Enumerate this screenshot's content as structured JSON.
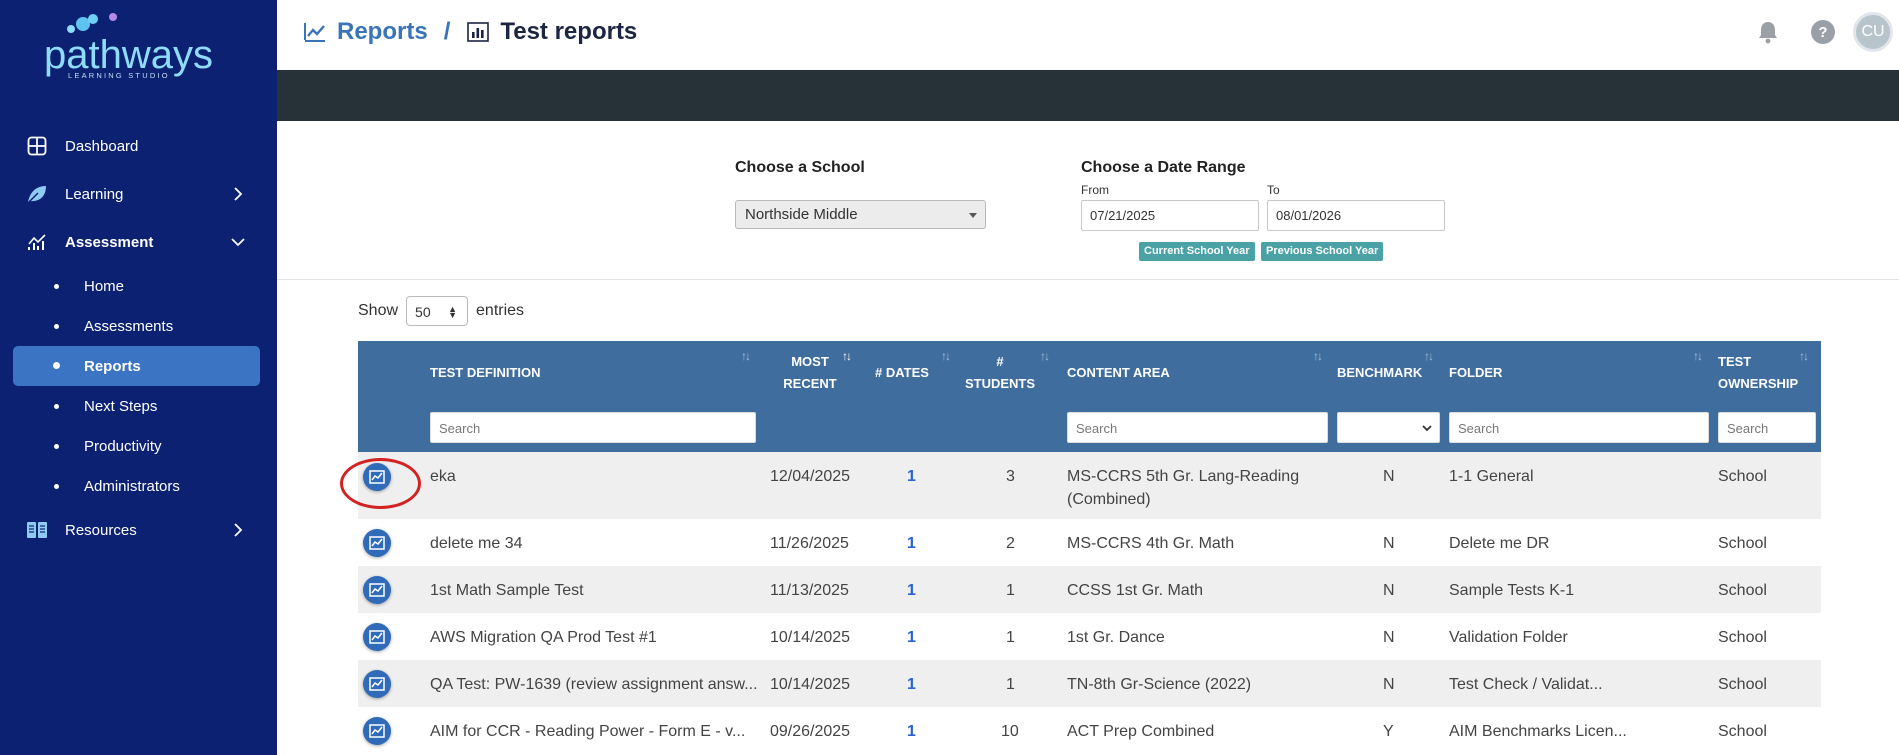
{
  "brand": {
    "name": "pathways",
    "tagline": "LEARNING STUDIO"
  },
  "sidebar": {
    "items": [
      {
        "label": "Dashboard",
        "icon": "grid-icon"
      },
      {
        "label": "Learning",
        "icon": "leaf-icon",
        "chevron": "right"
      },
      {
        "label": "Assessment",
        "icon": "chart-icon",
        "chevron": "down"
      },
      {
        "label": "Resources",
        "icon": "book-icon",
        "chevron": "right"
      }
    ],
    "assessment_sub": [
      {
        "label": "Home"
      },
      {
        "label": "Assessments"
      },
      {
        "label": "Reports",
        "active": true
      },
      {
        "label": "Next Steps"
      },
      {
        "label": "Productivity"
      },
      {
        "label": "Administrators"
      }
    ]
  },
  "header": {
    "breadcrumb_root": "Reports",
    "breadcrumb_sep": "/",
    "breadcrumb_current": "Test reports",
    "help_label": "?",
    "avatar_initials": "CU"
  },
  "filters": {
    "school_label": "Choose a School",
    "school_value": "Northside Middle",
    "date_label": "Choose a Date Range",
    "from_label": "From",
    "from_value": "07/21/2025",
    "to_label": "To",
    "to_value": "08/01/2026",
    "current_year_btn": "Current School Year",
    "previous_year_btn": "Previous School Year"
  },
  "table": {
    "show_label": "Show",
    "entries_label": "entries",
    "page_length": "50",
    "columns": {
      "test_definition": "TEST DEFINITION",
      "most_recent_1": "MOST",
      "most_recent_2": "RECENT",
      "dates": "# DATES",
      "students_1": "#",
      "students_2": "STUDENTS",
      "content_area": "CONTENT AREA",
      "benchmark": "BENCHMARK",
      "folder": "FOLDER",
      "ownership_1": "TEST",
      "ownership_2": "OWNERSHIP"
    },
    "search_placeholder": "Search",
    "rows": [
      {
        "test": "eka",
        "recent": "12/04/2025",
        "dates": "1",
        "students": "3",
        "content": "MS-CCRS 5th Gr. Lang-Reading",
        "content2": "(Combined)",
        "benchmark": "N",
        "folder": "1-1 General",
        "ownership": "School",
        "highlighted": true
      },
      {
        "test": "delete me 34",
        "recent": "11/26/2025",
        "dates": "1",
        "students": "2",
        "content": "MS-CCRS 4th Gr. Math",
        "content2": "",
        "benchmark": "N",
        "folder": "Delete me DR",
        "ownership": "School"
      },
      {
        "test": "1st Math Sample Test",
        "recent": "11/13/2025",
        "dates": "1",
        "students": "1",
        "content": "CCSS 1st Gr. Math",
        "content2": "",
        "benchmark": "N",
        "folder": "Sample Tests K-1",
        "ownership": "School"
      },
      {
        "test": "AWS Migration QA Prod Test #1",
        "recent": "10/14/2025",
        "dates": "1",
        "students": "1",
        "content": "1st Gr. Dance",
        "content2": "",
        "benchmark": "N",
        "folder": "Validation Folder",
        "ownership": "School"
      },
      {
        "test": "QA Test: PW-1639 (review assignment answ...",
        "recent": "10/14/2025",
        "dates": "1",
        "students": "1",
        "content": "TN-8th Gr-Science (2022)",
        "content2": "",
        "benchmark": "N",
        "folder": "Test Check / Validat...",
        "ownership": "School"
      },
      {
        "test": "AIM for CCR - Reading Power - Form E - v...",
        "recent": "09/26/2025",
        "dates": "1",
        "students": "10",
        "content": "ACT Prep Combined",
        "content2": "",
        "benchmark": "Y",
        "folder": "AIM Benchmarks Licen...",
        "ownership": "School"
      }
    ]
  },
  "colors": {
    "sidebar_bg": "#0d2173",
    "active_item": "#3a74c3",
    "table_header": "#3f6d9e",
    "accent_teal": "#4aa2a7",
    "dark_band": "#263238",
    "highlight_ring": "#d32222"
  }
}
